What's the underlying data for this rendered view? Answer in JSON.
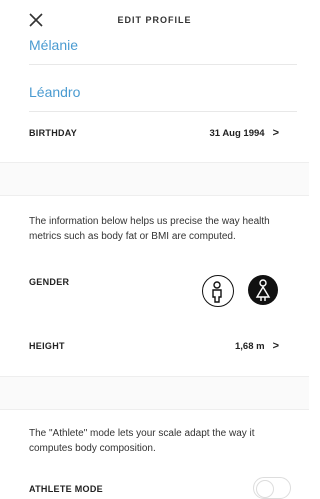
{
  "header": {
    "title": "EDIT PROFILE",
    "close_icon": "close-icon"
  },
  "profile": {
    "first_name": "Mélanie",
    "last_name": "Léandro",
    "birthday_label": "BIRTHDAY",
    "birthday_value": "31 Aug 1994"
  },
  "health_section": {
    "info_text": "The information below helps us precise the way health metrics such as body fat or BMI are computed.",
    "gender_label": "GENDER",
    "gender_icons": [
      "male-icon",
      "female-icon"
    ],
    "selected_gender": "female",
    "height_label": "HEIGHT",
    "height_value": "1,68 m"
  },
  "athlete_section": {
    "info_text": "The \"Athlete\" mode lets your scale adapt the way it computes body composition.",
    "label": "ATHLETE MODE",
    "enabled": false
  },
  "colors": {
    "accent": "#4a9bd1",
    "text": "#222222",
    "selected_icon_bg": "#111111"
  }
}
